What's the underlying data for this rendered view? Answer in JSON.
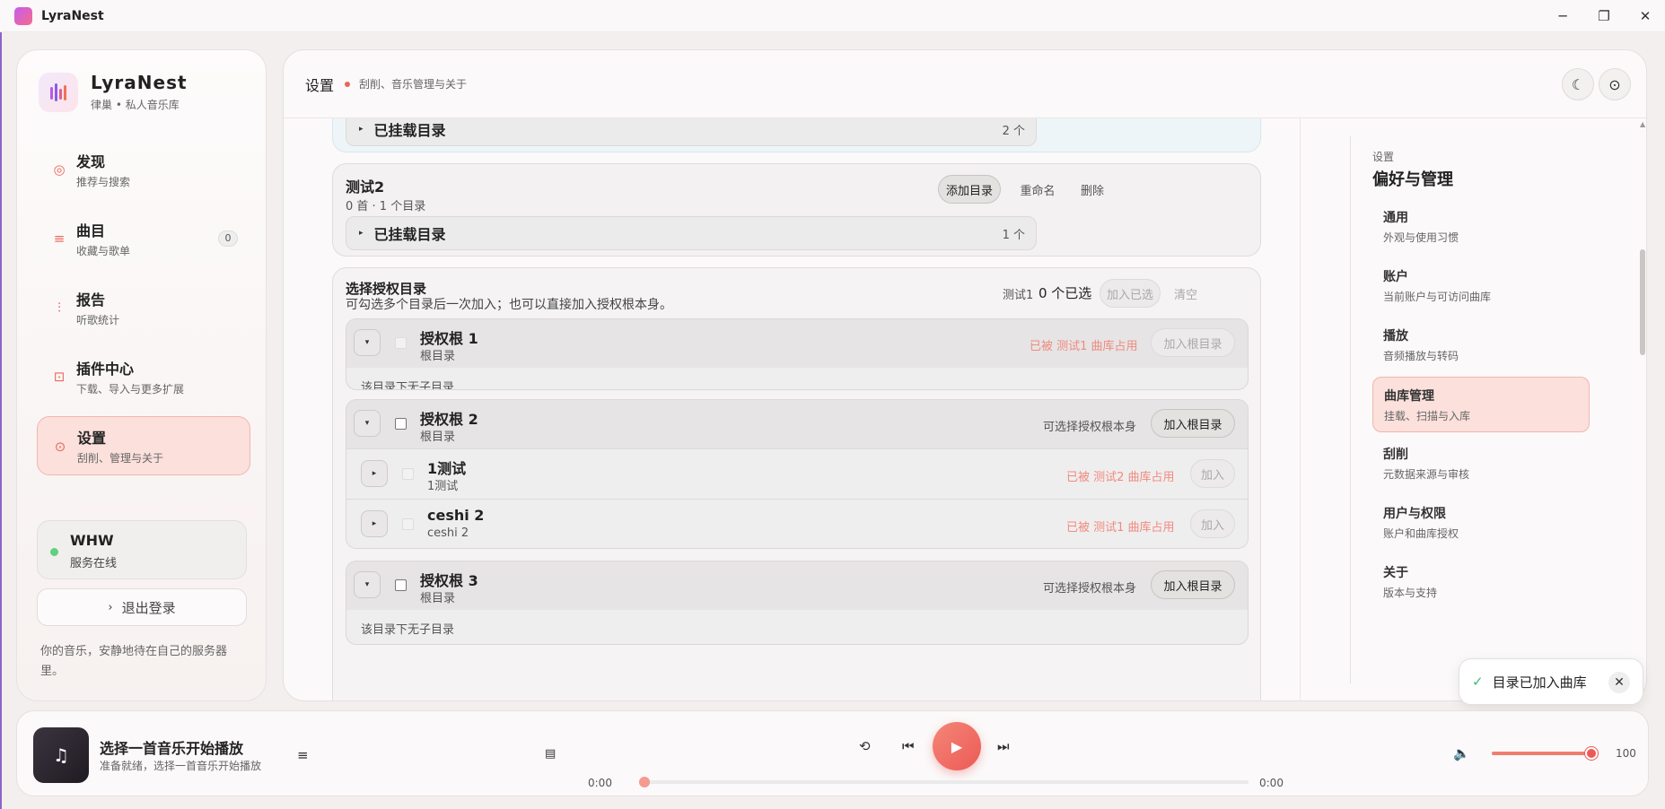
{
  "window": {
    "title": "LyraNest",
    "minimize": "─",
    "maximize": "❐",
    "close": "✕"
  },
  "brand": {
    "name": "LyraNest",
    "subtitle": "律巢 • 私人音乐库"
  },
  "nav": [
    {
      "title": "发现",
      "sub": "推荐与搜索",
      "icon": "compass-icon"
    },
    {
      "title": "曲目",
      "sub": "收藏与歌单",
      "icon": "list-icon",
      "badge": "0"
    },
    {
      "title": "报告",
      "sub": "听歌统计",
      "icon": "chart-icon"
    },
    {
      "title": "插件中心",
      "sub": "下载、导入与更多扩展",
      "icon": "plugin-icon"
    },
    {
      "title": "设置",
      "sub": "刮削、管理与关于",
      "icon": "settings-icon",
      "active": true
    }
  ],
  "user": {
    "name": "WHW",
    "status": "服务在线"
  },
  "logout": "退出登录",
  "footer_note": "你的音乐，安静地待在自己的服务器里。",
  "header": {
    "title": "设置",
    "subtitle": "刮削、音乐管理与关于"
  },
  "library_top": {
    "mounted_label": "已挂载目录",
    "mounted_count": "2 个"
  },
  "library2": {
    "name": "测试2",
    "stats": "0 首 · 1 个目录",
    "add_dir": "添加目录",
    "rename": "重命名",
    "delete": "删除",
    "mounted_label": "已挂载目录",
    "mounted_count": "1 个"
  },
  "picker": {
    "title": "选择授权目录",
    "desc": "可勾选多个目录后一次加入；也可以直接加入授权根本身。",
    "target": "测试1",
    "selected": "0 个已选",
    "add_selected": "加入已选",
    "clear": "清空",
    "roots": [
      {
        "name": "授权根 1",
        "sub": "根目录",
        "status": "已被 测试1 曲库占用",
        "btn": "加入根目录",
        "empty": "该目录下无子目录"
      },
      {
        "name": "授权根 2",
        "sub": "根目录",
        "status": "可选择授权根本身",
        "btn": "加入根目录",
        "children": [
          {
            "name": "1测试",
            "sub": "1测试",
            "status": "已被 测试2 曲库占用",
            "btn": "加入"
          },
          {
            "name": "ceshi 2",
            "sub": "ceshi 2",
            "status": "已被 测试1 曲库占用",
            "btn": "加入"
          }
        ]
      },
      {
        "name": "授权根 3",
        "sub": "根目录",
        "status": "可选择授权根本身",
        "btn": "加入根目录",
        "empty": "该目录下无子目录"
      }
    ]
  },
  "settings_nav": {
    "caption": "设置",
    "title": "偏好与管理",
    "items": [
      {
        "title": "通用",
        "sub": "外观与使用习惯"
      },
      {
        "title": "账户",
        "sub": "当前账户与可访问曲库"
      },
      {
        "title": "播放",
        "sub": "音频播放与转码"
      },
      {
        "title": "曲库管理",
        "sub": "挂载、扫描与入库",
        "active": true
      },
      {
        "title": "刮削",
        "sub": "元数据来源与审核"
      },
      {
        "title": "用户与权限",
        "sub": "账户和曲库授权"
      },
      {
        "title": "关于",
        "sub": "版本与支持"
      }
    ]
  },
  "toast": {
    "text": "目录已加入曲库"
  },
  "player": {
    "title": "选择一首音乐开始播放",
    "sub": "准备就绪，选择一首音乐开始播放",
    "time_current": "0:00",
    "time_total": "0:00",
    "progress": 0,
    "volume": 100,
    "volume_label": "100"
  },
  "colors": {
    "accent": "#ec5a55",
    "active_bg": "#fbe0dc",
    "online": "#5bd27d",
    "occupied": "#f08a80"
  }
}
